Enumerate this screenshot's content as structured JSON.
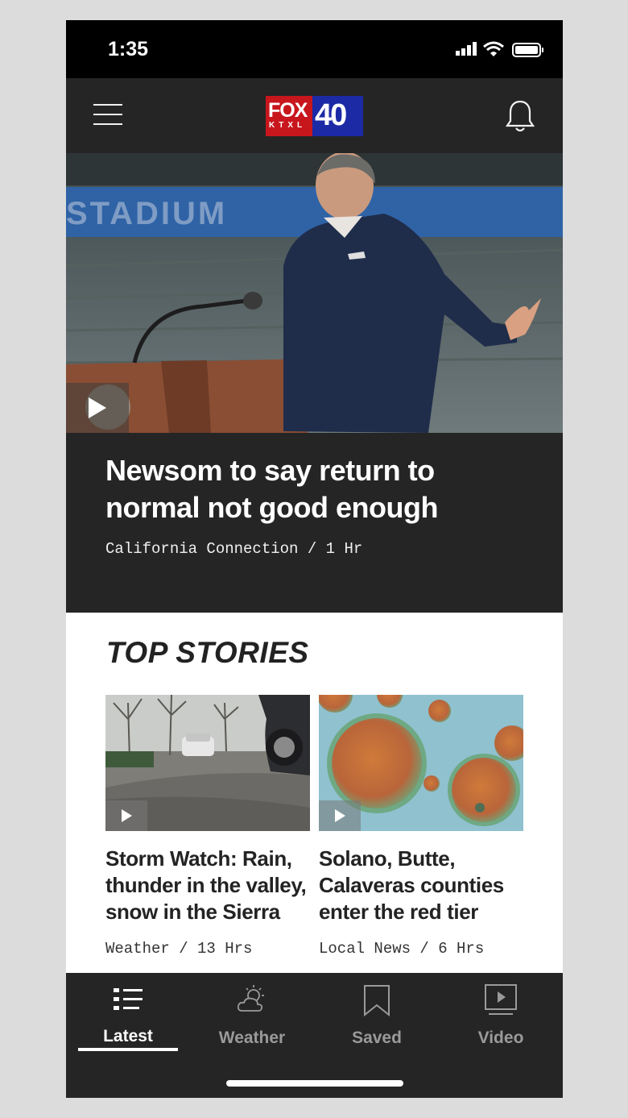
{
  "status_bar": {
    "time": "1:35"
  },
  "header": {
    "logo": {
      "fox": "FOX",
      "callsign": "KTXL",
      "channel": "40"
    }
  },
  "hero": {
    "title": "Newsom to say return to normal not good enough",
    "meta": "California Connection / 1 Hr"
  },
  "top_stories": {
    "heading": "TOP STORIES",
    "items": [
      {
        "title": "Storm Watch: Rain, thunder in the valley, snow in the Sierra",
        "meta": "Weather / 13 Hrs"
      },
      {
        "title": "Solano, Butte, Calaveras counties enter the red tier",
        "meta": "Local News / 6 Hrs"
      }
    ]
  },
  "tabs": [
    {
      "label": "Latest",
      "icon": "list-icon",
      "active": true
    },
    {
      "label": "Weather",
      "icon": "weather-icon",
      "active": false
    },
    {
      "label": "Saved",
      "icon": "bookmark-icon",
      "active": false
    },
    {
      "label": "Video",
      "icon": "video-icon",
      "active": false
    }
  ],
  "colors": {
    "header_bg": "#252525",
    "fox_red": "#c8161d",
    "fox_blue": "#1c2aa6"
  }
}
